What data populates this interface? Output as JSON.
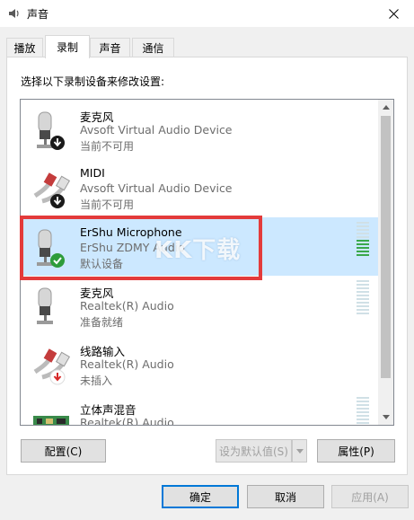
{
  "window": {
    "title": "声音"
  },
  "tabs": [
    {
      "label": "播放"
    },
    {
      "label": "录制"
    },
    {
      "label": "声音"
    },
    {
      "label": "通信"
    }
  ],
  "instruction": "选择以下录制设备来修改设置:",
  "devices": [
    {
      "name": "麦克风",
      "description": "Avsoft Virtual Audio Device",
      "status": "当前不可用",
      "icon": "microphone-icon",
      "badge": "down-arrow-badge"
    },
    {
      "name": "MIDI",
      "description": "Avsoft Virtual Audio Device",
      "status": "当前不可用",
      "icon": "midi-cable-icon",
      "badge": "down-arrow-badge"
    },
    {
      "name": "ErShu Microphone",
      "description": "ErShu ZDMY Audio",
      "status": "默认设备",
      "icon": "microphone-icon",
      "badge": "green-check-badge",
      "level": 0.5
    },
    {
      "name": "麦克风",
      "description": "Realtek(R) Audio",
      "status": "准备就绪",
      "icon": "microphone-icon",
      "badge": "",
      "level": 0
    },
    {
      "name": "线路输入",
      "description": "Realtek(R) Audio",
      "status": "未插入",
      "icon": "line-in-cable-icon",
      "badge": "red-down-arrow-badge"
    },
    {
      "name": "立体声混音",
      "description": "Realtek(R) Audio",
      "status": "",
      "icon": "sound-card-icon",
      "badge": "",
      "level": 0
    }
  ],
  "watermark": {
    "text": "KK下载"
  },
  "buttons": {
    "configure": "配置(C)",
    "set_default": "设为默认值(S)",
    "properties": "属性(P)",
    "ok": "确定",
    "cancel": "取消",
    "apply": "应用(A)"
  },
  "colors": {
    "selection": "#cce8ff",
    "highlight_box": "#e33b3b",
    "level_on": "#3aa84b"
  }
}
